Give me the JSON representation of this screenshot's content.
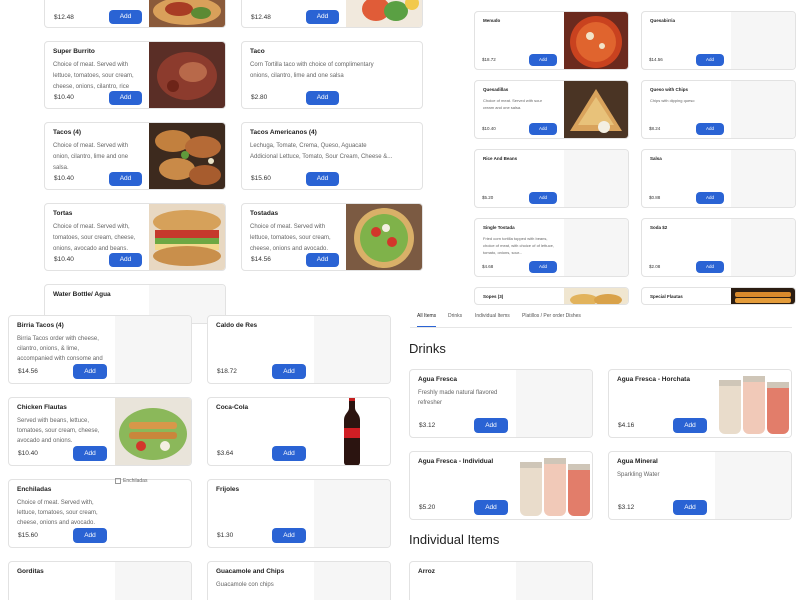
{
  "colors": {
    "accent": "#2a63d4"
  },
  "tabs": [
    {
      "label": "All Items",
      "active": true
    },
    {
      "label": "Drinks",
      "active": false
    },
    {
      "label": "Individual Items",
      "active": false
    },
    {
      "label": "Platillos / Per order Dishes",
      "active": false
    }
  ],
  "sections": {
    "drinks": "Drinks",
    "individual": "Individual Items"
  },
  "add_label": "Add",
  "broken_image_alt": "Enchiladas",
  "top_left": [
    {
      "name": "",
      "desc": "",
      "price": "$12.48",
      "image": "taco-photo"
    },
    {
      "name": "",
      "desc": "",
      "price": "$12.48",
      "image": "drink-photo"
    },
    {
      "name": "Super Burrito",
      "desc": "Choice of meat. Served with lettuce, tomatoes, sour cream, cheese, onions, cilantro, rice and...",
      "price": "$10.40",
      "image": "burrito-photo"
    },
    {
      "name": "Taco",
      "desc": "Corn Tortilla taco with choice of complimentary onions, cilantro, lime and one salsa",
      "price": "$2.80",
      "image": ""
    },
    {
      "name": "Tacos (4)",
      "desc": "Choice of meat. Served with onion, cilantro, lime and one salsa.",
      "price": "$10.40",
      "image": "tacos-photo"
    },
    {
      "name": "Tacos Americanos (4)",
      "desc": "Lechuga, Tomate, Crema, Queso, Aguacate Addicional Lettuce, Tomato, Sour Cream, Cheese &...",
      "price": "$15.60",
      "image": ""
    },
    {
      "name": "Tortas",
      "desc": "Choice of meat. Served with, tomatoes, sour cream, cheese, onions, avocado and beans.",
      "price": "$10.40",
      "image": "torta-photo"
    },
    {
      "name": "Tostadas",
      "desc": "Choice of meat. Served with lettuce, tomatoes, sour cream, cheese, onions and avocado.",
      "price": "$14.56",
      "image": "tostada-photo"
    },
    {
      "name": "Water Bottle/ Agua",
      "desc": "",
      "price": "",
      "image": ""
    }
  ],
  "top_right": [
    {
      "name": "Menudo",
      "desc": "",
      "price": "$18.72",
      "image": "menudo-photo"
    },
    {
      "name": "Quesabirria",
      "desc": "",
      "price": "$14.56",
      "image": ""
    },
    {
      "name": "Quesadillas",
      "desc": "Choice of meat. Served with sour cream and one salsa.",
      "price": "$10.40",
      "image": "quesadilla-photo"
    },
    {
      "name": "Queso with Chips",
      "desc": "Chips with dipping queso",
      "price": "$8.24",
      "image": ""
    },
    {
      "name": "Rice And Beans",
      "desc": "",
      "price": "$5.20",
      "image": ""
    },
    {
      "name": "Salsa",
      "desc": "",
      "price": "$0.88",
      "image": ""
    },
    {
      "name": "Single Tostada",
      "desc": "Fried corn tortilla topped with beans, choice of meat, with choice of of lettuce, tomato, onions, sour...",
      "price": "$4.68",
      "image": ""
    },
    {
      "name": "Soda $2",
      "desc": "",
      "price": "$2.08",
      "image": ""
    },
    {
      "name": "Sopes (3)",
      "desc": "",
      "price": "",
      "image": "sopes-photo"
    },
    {
      "name": "Special Flautas",
      "desc": "",
      "price": "",
      "image": "flautas-photo"
    }
  ],
  "bottom_left": [
    {
      "name": "Birria Tacos (4)",
      "desc": "Birria Tacos order with cheese, cilantro, onions, & lime, accompanied with consome and a...",
      "price": "$14.56",
      "image": ""
    },
    {
      "name": "Caldo de Res",
      "desc": "",
      "price": "$18.72",
      "image": ""
    },
    {
      "name": "Chicken Flautas",
      "desc": "Served with beans, lettuce, tomatoes, sour cream, cheese, avocado and onions.",
      "price": "$10.40",
      "image": "flautas-photo"
    },
    {
      "name": "Coca-Cola",
      "desc": "",
      "price": "$3.64",
      "image": "coke-bottle"
    },
    {
      "name": "Enchiladas",
      "desc": "Choice of meat. Served with, lettuce, tomatoes, sour cream, cheese, onions and avocado.",
      "price": "$15.60",
      "image": ""
    },
    {
      "name": "Frijoles",
      "desc": "",
      "price": "$1.30",
      "image": ""
    },
    {
      "name": "Gorditas",
      "desc": "",
      "price": "",
      "image": ""
    },
    {
      "name": "Guacamole and Chips",
      "desc": "Guacamole con chips",
      "price": "",
      "image": ""
    }
  ],
  "drinks": [
    {
      "name": "Agua Fresca",
      "desc": "Freshly made natural flavored refresher",
      "price": "$3.12",
      "image": ""
    },
    {
      "name": "Agua Fresca - Horchata",
      "desc": "",
      "price": "$4.16",
      "image": "agua-fresca-jars"
    },
    {
      "name": "Agua Fresca - Individual",
      "desc": "",
      "price": "$5.20",
      "image": "agua-fresca-jars"
    },
    {
      "name": "Agua Mineral",
      "desc": "Sparkling Water",
      "price": "$3.12",
      "image": ""
    }
  ],
  "individual": [
    {
      "name": "Arroz",
      "desc": "",
      "price": "",
      "image": ""
    }
  ]
}
